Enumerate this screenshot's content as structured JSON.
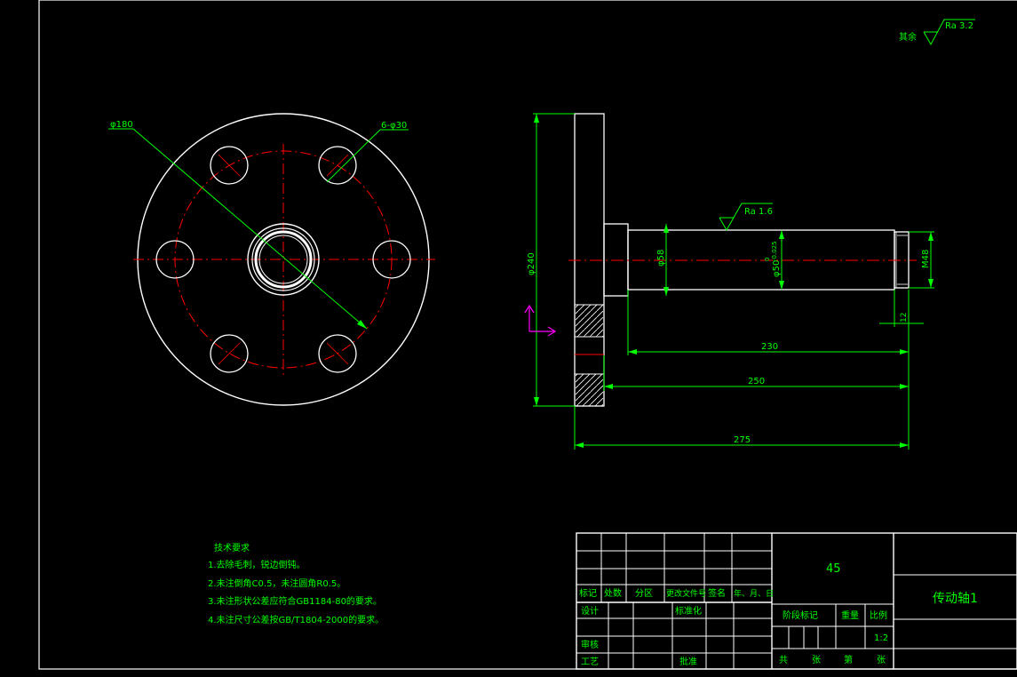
{
  "colors": {
    "background": "#000000",
    "outline": "#ffffff",
    "dimension": "#00ff00",
    "centerline": "#ff0000",
    "ucs": "#ff00ff"
  },
  "roughness_general": {
    "prefix": "其余",
    "value": "Ra 3.2"
  },
  "roughness_shaft": {
    "value": "Ra 1.6"
  },
  "dimensions": {
    "d_outer": "φ180",
    "holes": "6-φ30",
    "d_flange": "φ240",
    "d_step": "φ58",
    "d_shaft": "φ50",
    "tol_upper": "0",
    "tol_lower": "-0.025",
    "thread": "M48",
    "thread_len": "12",
    "len_230": "230",
    "len_250": "250",
    "len_275": "275"
  },
  "tech": {
    "title": "技术要求",
    "items": [
      "1.去除毛刺，锐边倒钝。",
      "2.未注倒角C0.5，未注圆角R0.5。",
      "3.未注形状公差应符合GB1184-80的要求。",
      "4.未注尺寸公差按GB/T1804-2000的要求。"
    ]
  },
  "title_block": {
    "material": "45",
    "part_name": "传动轴1",
    "headers": [
      "标记",
      "处数",
      "分区",
      "更改文件号",
      "签名",
      "年、月、日"
    ],
    "design": "设计",
    "standardize": "标准化",
    "check": "审核",
    "process": "工艺",
    "approve": "批准",
    "stage_mark": "阶段标记",
    "weight": "重量",
    "scale_label": "比例",
    "scale_value": "1:2",
    "total": "共",
    "sheet_unit": "张",
    "sheet_no": "第",
    "sheet_unit2": "张"
  }
}
